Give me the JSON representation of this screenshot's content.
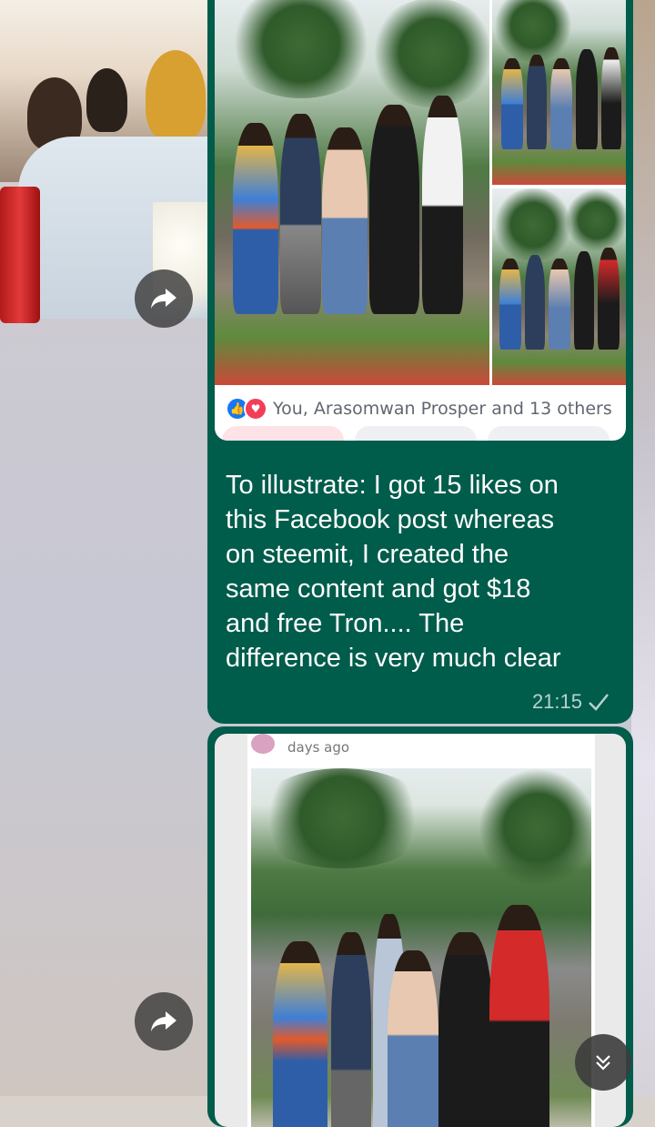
{
  "chat": {
    "message1": {
      "reactions_text": "You, Arasomwan Prosper and 13 others",
      "like_count": "15",
      "body": "To illustrate: I got 15 likes on\nthis Facebook post whereas\non steemit, I created the\nsame content and got $18\nand free Tron.... The\ndifference is very much clear",
      "time": "21:15",
      "status_icon": "single-check-icon"
    },
    "message2": {
      "post_age": "days ago"
    }
  },
  "icons": {
    "forward": "forward-arrow-icon",
    "scroll_down": "double-chevron-down-icon"
  },
  "colors": {
    "outgoing_bubble": "#005c4b",
    "like_blue": "#1877f2",
    "love_red": "#f33e58"
  }
}
